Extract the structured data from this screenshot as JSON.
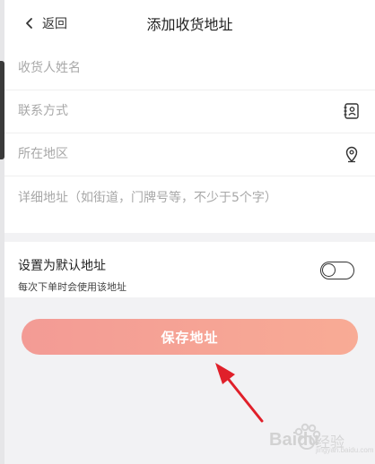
{
  "header": {
    "back_label": "返回",
    "title": "添加收货地址"
  },
  "form": {
    "name_placeholder": "收货人姓名",
    "phone_placeholder": "联系方式",
    "region_placeholder": "所在地区",
    "detail_placeholder": "详细地址（如街道，门牌号等，不少于5个字）"
  },
  "default_setting": {
    "title": "设置为默认地址",
    "subtitle": "每次下单时会使用该地址",
    "enabled": false
  },
  "save_button": {
    "label": "保存地址"
  },
  "watermark": {
    "logo_text": "Baidu",
    "cn_text": "经验",
    "url": "jingyan.baidu.com"
  },
  "colors": {
    "button_gradient_start": "#f39b95",
    "button_gradient_end": "#f8ab95",
    "arrow": "#e0202a",
    "background": "#f2f2f4"
  },
  "icons": {
    "back": "chevron-left-icon",
    "contacts": "contacts-book-icon",
    "location": "location-pin-icon",
    "watermark_logo": "paw-logo-icon"
  }
}
